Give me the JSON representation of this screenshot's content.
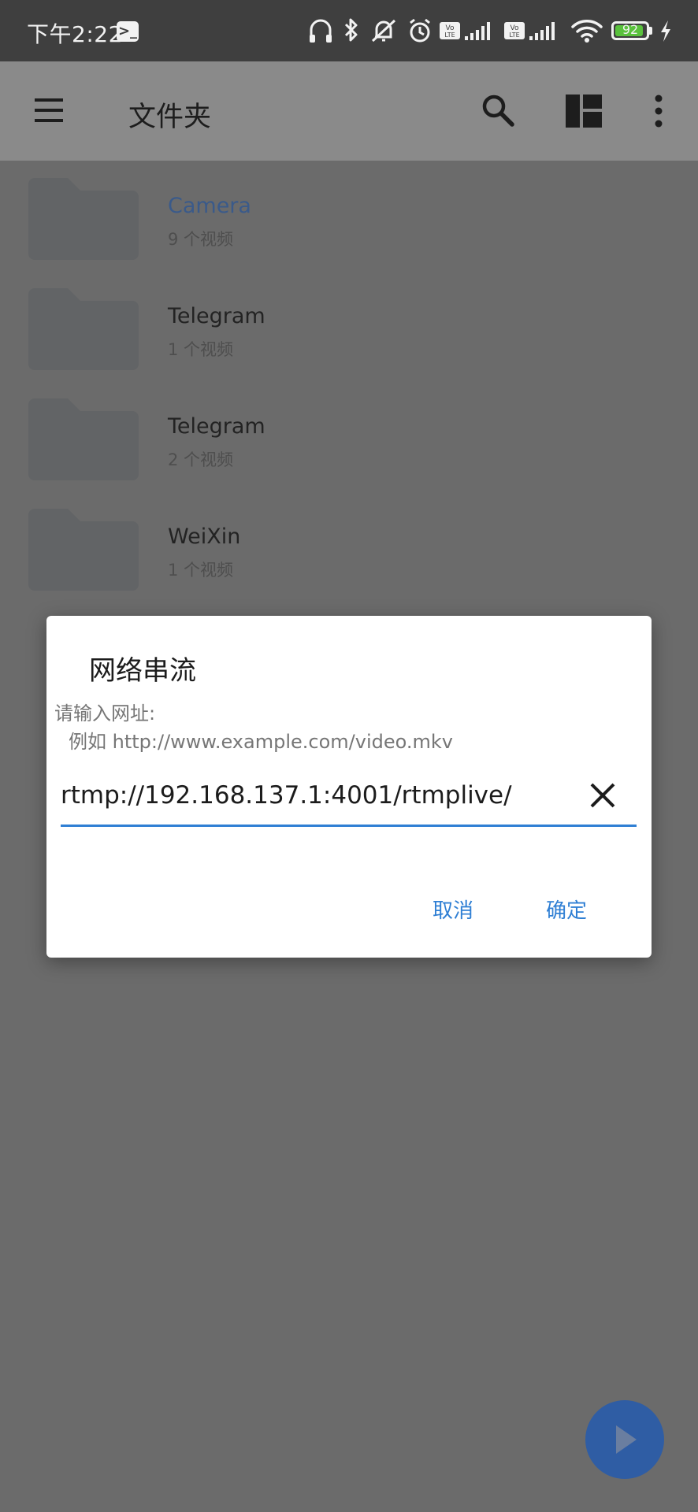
{
  "status_bar": {
    "time": "下午2:22",
    "battery": "92",
    "battery_level": 0.92,
    "icons": [
      "terminal-icon",
      "headphones-icon",
      "bluetooth-icon",
      "mute-icon",
      "alarm-icon",
      "volte-icon",
      "signal-icon",
      "wifi-icon",
      "battery-icon",
      "charging-icon"
    ]
  },
  "appbar": {
    "title": "文件夹",
    "icons": [
      "menu-icon",
      "search-icon",
      "layout-icon",
      "more-icon"
    ]
  },
  "folders": [
    {
      "name": "Camera",
      "count": "9 个视频"
    },
    {
      "name": "Telegram",
      "count": "1 个视频"
    },
    {
      "name": "Telegram",
      "count": "2 个视频"
    },
    {
      "name": "WeiXin",
      "count": "1 个视频"
    }
  ],
  "dialog": {
    "title": "网络串流",
    "message": "请输入网址:",
    "example": "例如 http://www.example.com/video.mkv",
    "url_value": "rtmp://192.168.137.1:4001/rtmplive/",
    "cancel_label": "取消",
    "ok_label": "确定"
  },
  "colors": {
    "accent": "#2f7fd4",
    "fab": "#2f5da4",
    "camera_label": "#3a5a8a"
  }
}
